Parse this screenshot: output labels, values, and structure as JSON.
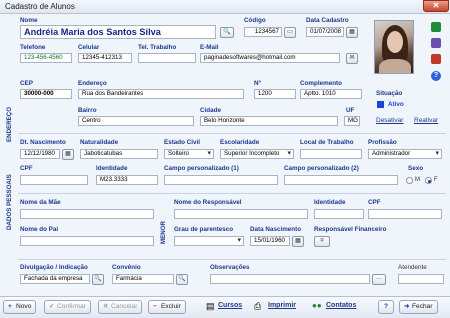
{
  "window": {
    "title": "Cadastro de Alunos",
    "close": "✕"
  },
  "aluno": {
    "nome_label": "Nome",
    "nome": "Andréia Maria dos Santos Silva",
    "codigo_label": "Código",
    "codigo": "1234567",
    "data_cadastro_label": "Data Cadastro",
    "data_cadastro": "01/07/2008"
  },
  "contato": {
    "telefone_label": "Telefone",
    "telefone": "123-456-4560",
    "celular_label": "Celular",
    "celular": "12345-412313",
    "tel_trabalho_label": "Tel. Trabalho",
    "tel_trabalho": "",
    "email_label": "E-Mail",
    "email": "paginadesoftwares@hotmail.com"
  },
  "endereco": {
    "section": "ENDEREÇO",
    "cep_label": "CEP",
    "cep": "30000-000",
    "endereco_label": "Endereço",
    "endereco": "Rua dos Bandeirantes",
    "numero_label": "Nº",
    "numero": "1200",
    "complemento_label": "Complemento",
    "complemento": "Aptto. 1010",
    "bairro_label": "Bairro",
    "bairro": "Centro",
    "cidade_label": "Cidade",
    "cidade": "Belo Horizonte",
    "uf_label": "UF",
    "uf": "MG"
  },
  "situacao": {
    "label": "Situação",
    "value": "Ativo",
    "desativar": "Desativar",
    "reativar": "Reativar"
  },
  "pessoais": {
    "section": "DADOS PESSOAIS",
    "dt_nasc_label": "Dt. Nascimento",
    "dt_nasc": "12/12/1980",
    "naturalidade_label": "Naturalidade",
    "naturalidade": "Jaboticatubas",
    "estado_civil_label": "Estado Civil",
    "estado_civil": "Solteiro",
    "escolaridade_label": "Escolaridade",
    "escolaridade": "Superior Incompleto",
    "local_trabalho_label": "Local de Trabalho",
    "local_trabalho": "",
    "profissao_label": "Profissão",
    "profissao": "Administrador",
    "cpf_label": "CPF",
    "cpf": "",
    "identidade_label": "Identidade",
    "identidade": "M23.3333",
    "campo1_label": "Campo personalizado (1)",
    "campo1": "",
    "campo2_label": "Campo personalizado (2)",
    "campo2": "",
    "sexo_label": "Sexo",
    "sexo_m": "M",
    "sexo_f": "F"
  },
  "familia": {
    "mae_label": "Nome da Mãe",
    "mae": "",
    "pai_label": "Nome do Pai",
    "pai": ""
  },
  "menor": {
    "section": "MENOR",
    "responsavel_label": "Nome do Responsável",
    "responsavel": "",
    "identidade_label": "Identidade",
    "identidade": "",
    "cpf_label": "CPF",
    "cpf": "",
    "parentesco_label": "Grau de parentesco",
    "parentesco": "",
    "data_nasc_label": "Data Nascimento",
    "data_nasc": "15/01/1960",
    "resp_fin_label": "Responsável Financeiro",
    "resp_fin_btn": "="
  },
  "divulgacao": {
    "label": "Divulgação / Indicação",
    "value": "Fachada da empresa",
    "convenio_label": "Convênio",
    "convenio": "Farmácia",
    "obs_label": "Observações",
    "obs": "",
    "atendente_label": "Atendente",
    "atendente": ""
  },
  "toolbar": {
    "novo": "Novo",
    "confirmar": "Confirmar",
    "cancelar": "Cancelar",
    "excluir": "Excluir",
    "cursos": "Cursos",
    "imprimir": "Imprimir",
    "contatos": "Contatos",
    "help": "?",
    "fechar": "Fechar"
  },
  "colors": {
    "accent": "#1c3a8c",
    "status": "#1d43d6",
    "green_text": "#0a7a20"
  }
}
